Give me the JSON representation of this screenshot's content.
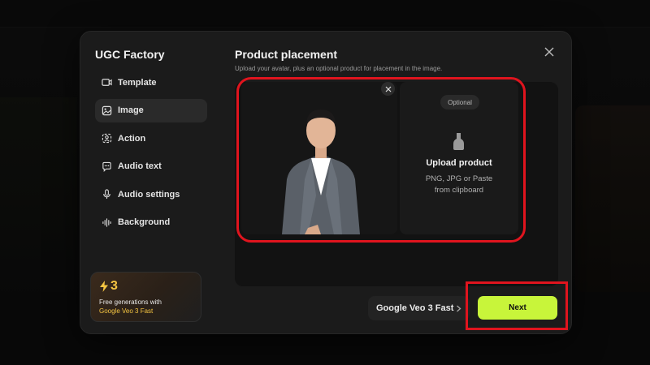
{
  "app": {
    "title": "UGC Factory"
  },
  "sidebar": {
    "items": [
      {
        "label": "Template",
        "icon": "video-icon"
      },
      {
        "label": "Image",
        "icon": "image-icon",
        "active": true
      },
      {
        "label": "Action",
        "icon": "person-action-icon"
      },
      {
        "label": "Audio text",
        "icon": "speech-bubble-icon"
      },
      {
        "label": "Audio settings",
        "icon": "microphone-icon"
      },
      {
        "label": "Background",
        "icon": "sound-wave-icon"
      }
    ],
    "promo": {
      "count": "3",
      "line1": "Free generations with",
      "line2": "Google Veo 3 Fast"
    }
  },
  "main": {
    "title": "Product placement",
    "subtitle": "Upload your avatar, plus an optional product for placement in the image.",
    "product_panel": {
      "badge": "Optional",
      "title": "Upload product",
      "hint_line1": "PNG, JPG or Paste",
      "hint_line2": "from clipboard"
    }
  },
  "footer": {
    "model": "Google Veo 3 Fast",
    "next_label": "Next"
  },
  "colors": {
    "accent": "#c8f53a",
    "highlight": "#e0141e",
    "promo_text": "#f5c542",
    "modal_bg": "#1b1b1b"
  }
}
